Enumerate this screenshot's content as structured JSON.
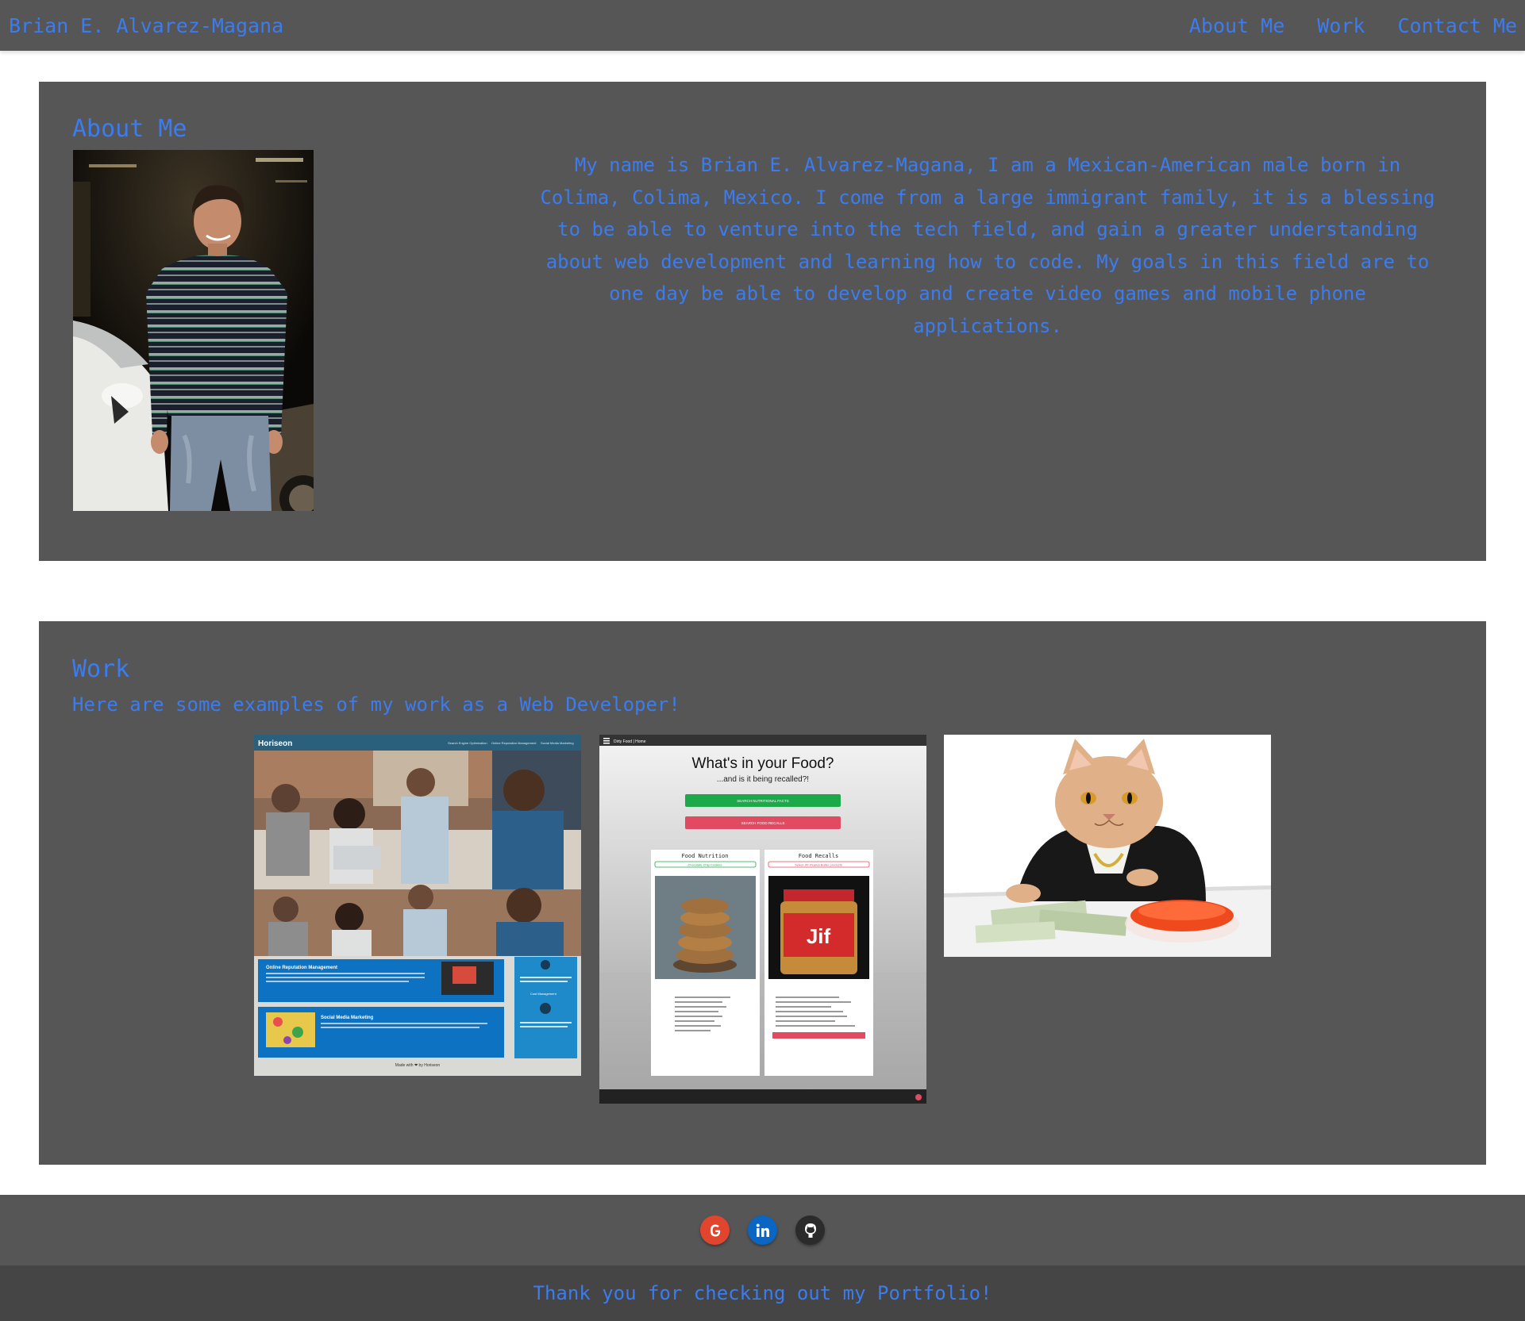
{
  "nav": {
    "brand": "Brian E. Alvarez-Magana",
    "links": [
      "About Me",
      "Work",
      "Contact Me"
    ]
  },
  "about": {
    "title": "About Me",
    "text": "My name is Brian E. Alvarez-Magana, I am a Mexican-American male born in Colima, Colima, Mexico. I come from a large immigrant family, it is a blessing to be able to venture into the tech field, and gain a greater understanding about web development and learning how to code. My goals in this field are to one day be able to develop and create video games and mobile phone applications."
  },
  "work": {
    "title": "Work",
    "subtitle": "Here are some examples of my work as a Web Developer!",
    "projects": [
      {
        "brand": "Horiseon",
        "nav_items": [
          "Search Engine Optimization",
          "Online Reputation Management",
          "Social Media Marketing"
        ],
        "sections": [
          "Online Reputation Management",
          "Social Media Marketing"
        ],
        "sidebar_heading": "Cost Management",
        "footer": "Made with ❤ by Horiseon"
      },
      {
        "nav_title": "Dirty Food | Home",
        "heading": "What's in your Food?",
        "subheading": "...and is it being recalled?!",
        "btn_nutrition": "SEARCH NUTRITIONAL FACTS",
        "btn_recalls": "SEARCH FOOD RECALLS",
        "col_nutrition": "Food Nutrition",
        "col_recalls": "Food Recalls",
        "chip_nutrition": "Chocolate Chip Cookies",
        "chip_recalls": "Select JIF Peanut Butter products",
        "jar_label": "Jif"
      },
      {}
    ]
  },
  "footer": {
    "socials": [
      "Google",
      "LinkedIn",
      "GitHub"
    ],
    "text": "Thank you for checking out my Portfolio!"
  },
  "colors": {
    "accent": "#3b7cf0",
    "panel": "#565656",
    "footer_bar": "#454545",
    "google": "#e2452e",
    "linkedin": "#0a66c2",
    "github": "#2b2b2b"
  }
}
